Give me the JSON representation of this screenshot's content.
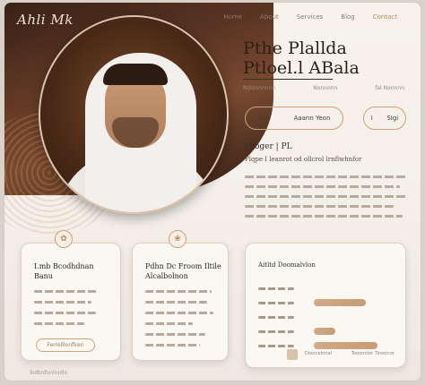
{
  "brand": {
    "name": "Ahli Mk"
  },
  "nav": {
    "items": [
      "Home",
      "About",
      "Services",
      "Blog",
      "Contact"
    ],
    "active_index": 4
  },
  "hero": {
    "title_line1": "Pthe Plallda",
    "title_line2": "Ptloel.l ABala",
    "meta_left": "Nolonnnnnn",
    "meta_mid": "Nonnnnn",
    "meta_right": "fal  Nonnnn"
  },
  "pill": {
    "left": "Sigi",
    "right": "Aaann   Yeon"
  },
  "pill_small": {
    "left": "I",
    "right": "SIgi"
  },
  "section": {
    "heading": "Peoger  |  PL",
    "subheading": "Plqpe  I  leanrot  od  ollcrol  lrnflwhnfor"
  },
  "cards": [
    {
      "title_line1": "I.mb Bcodhdnan",
      "title_line2": "Banu",
      "button": "Ferrelllonflren"
    },
    {
      "title_line1": "Pdhn  Dc Froom  Iltile",
      "title_line2": "Alcalbolnon"
    }
  ],
  "stats": {
    "title": "Aitltd  Doomalvlon",
    "bars": [
      0.0,
      0.62,
      0.0,
      0.26,
      0.75
    ],
    "foot_left": "Doorcelnnal",
    "foot_right": "Tooonnlor  Tiroorcor"
  },
  "footer": "Ilolbnfonlnnllo",
  "colors": {
    "accent": "#c9a37c",
    "dark": "#3a2218",
    "bar": "#c69b78"
  }
}
